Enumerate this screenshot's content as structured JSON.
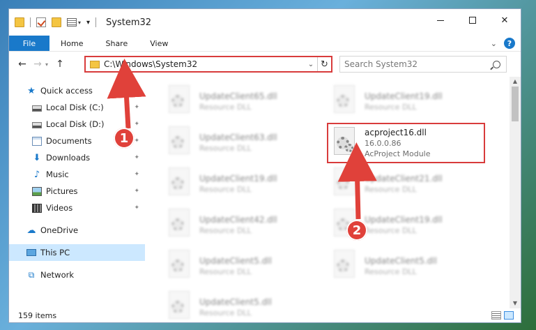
{
  "window": {
    "title": "System32",
    "controls": {
      "minimize": "–",
      "maximize": "☐",
      "close": "✕"
    }
  },
  "ribbon": {
    "tabs": [
      "File",
      "Home",
      "Share",
      "View"
    ]
  },
  "address": {
    "path": "C:\\Windows\\System32",
    "search_placeholder": "Search System32"
  },
  "nav": {
    "quick_access": "Quick access",
    "items": [
      {
        "label": "Local Disk (C:)",
        "icon": "disk-icon",
        "pinned": true
      },
      {
        "label": "Local Disk (D:)",
        "icon": "disk-icon",
        "pinned": true
      },
      {
        "label": "Documents",
        "icon": "documents-icon",
        "pinned": true
      },
      {
        "label": "Downloads",
        "icon": "download-icon",
        "pinned": true
      },
      {
        "label": "Music",
        "icon": "music-icon",
        "pinned": true
      },
      {
        "label": "Pictures",
        "icon": "pictures-icon",
        "pinned": true
      },
      {
        "label": "Videos",
        "icon": "videos-icon",
        "pinned": true
      }
    ],
    "onedrive": "OneDrive",
    "this_pc": "This PC",
    "network": "Network"
  },
  "files": {
    "left_column": [
      {
        "name": "UpdateClient65.dll",
        "type": "Resource DLL"
      },
      {
        "name": "UpdateClient63.dll",
        "type": "Resource DLL"
      },
      {
        "name": "UpdateClient19.dll",
        "type": "Resource DLL"
      },
      {
        "name": "UpdateClient42.dll",
        "type": "Resource DLL"
      },
      {
        "name": "UpdateClient5.dll",
        "type": "Resource DLL"
      },
      {
        "name": "UpdateClient5.dll",
        "type": "Resource DLL"
      }
    ],
    "right_column": [
      {
        "name": "UpdateClient19.dll",
        "type": "Resource DLL"
      },
      {
        "name": "UpdateClient21.dll",
        "type": "Resource DLL"
      },
      {
        "name": "UpdateClient19.dll",
        "type": "Resource DLL"
      },
      {
        "name": "UpdateClient5.dll",
        "type": "Resource DLL"
      }
    ],
    "highlighted": {
      "name": "acproject16.dll",
      "version": "16.0.0.86",
      "description": "AcProject Module"
    }
  },
  "status": {
    "item_count": "159 items"
  },
  "callouts": {
    "one": "1",
    "two": "2"
  },
  "colors": {
    "accent": "#1979ca",
    "highlight": "#d83b3b",
    "callout": "#e0413a"
  }
}
